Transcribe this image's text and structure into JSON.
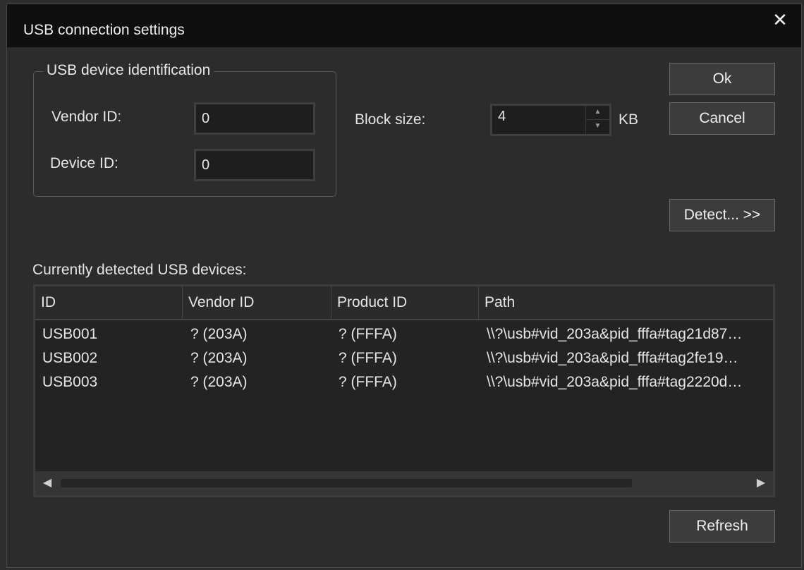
{
  "window": {
    "title": "USB connection settings",
    "close_glyph": "✕"
  },
  "identification": {
    "legend": "USB device identification",
    "vendor_label": "Vendor ID:",
    "vendor_value": "0",
    "device_label": "Device ID:",
    "device_value": "0"
  },
  "block": {
    "label": "Block size:",
    "value": "4",
    "unit": "KB"
  },
  "buttons": {
    "ok": "Ok",
    "cancel": "Cancel",
    "detect": "Detect... >>",
    "refresh": "Refresh"
  },
  "devices": {
    "label": "Currently detected USB devices:",
    "columns": [
      "ID",
      "Vendor ID",
      "Product ID",
      "Path"
    ],
    "rows": [
      [
        "USB001",
        "? (203A)",
        "? (FFFA)",
        "\\\\?\\usb#vid_203a&pid_fffa#tag21d87…"
      ],
      [
        "USB002",
        "? (203A)",
        "? (FFFA)",
        "\\\\?\\usb#vid_203a&pid_fffa#tag2fe19…"
      ],
      [
        "USB003",
        "? (203A)",
        "? (FFFA)",
        "\\\\?\\usb#vid_203a&pid_fffa#tag2220d…"
      ]
    ]
  },
  "icons": {
    "close": "close-icon",
    "scroll_left": "chevron-left-icon",
    "scroll_right": "chevron-right-icon",
    "spin_up": "chevron-up-icon",
    "spin_down": "chevron-down-icon"
  }
}
